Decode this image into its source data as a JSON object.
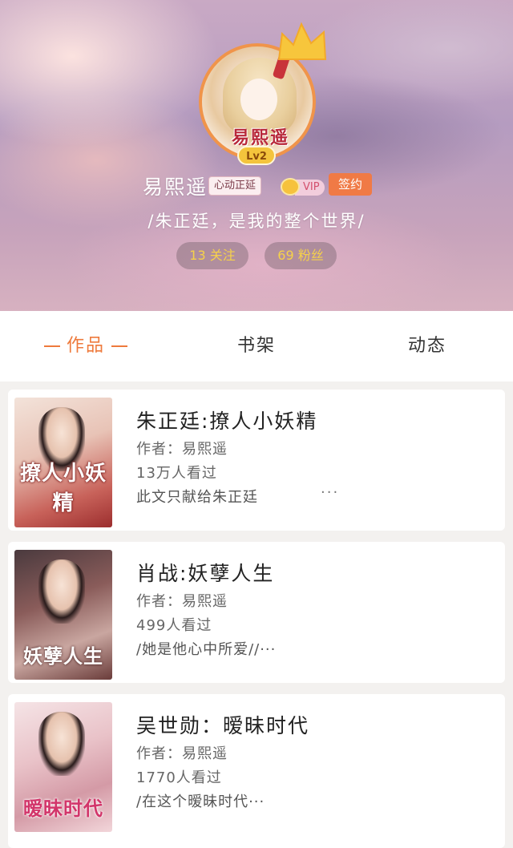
{
  "profile": {
    "username": "易熙遥",
    "tag": "心动正延",
    "vip_label": "VIP",
    "sign_label": "签约",
    "level": "Lv2",
    "avatar_signature": "易熙遥",
    "bio": "/朱正廷，是我的整个世界/",
    "following": "13 关注",
    "fans": "69 粉丝"
  },
  "tabs": {
    "works": "作品",
    "shelf": "书架",
    "feed": "动态",
    "active": "works"
  },
  "books": [
    {
      "title": "朱正廷:撩人小妖精",
      "author": "作者：易熙遥",
      "views": "13万人看过",
      "desc": "此文只献给朱正廷",
      "more": "···",
      "cover_text": "撩人小妖精"
    },
    {
      "title": "肖战:妖孽人生",
      "author": "作者：易熙遥",
      "views": "499人看过",
      "desc": "/她是他心中所爱//···",
      "cover_text": "妖孽人生"
    },
    {
      "title": "吴世勋：暧昧时代",
      "author": "作者：易熙遥",
      "views": "1770人看过",
      "desc": "/在这个暧昧时代···",
      "cover_text": "暧昧时代"
    }
  ],
  "colors": {
    "accent": "#ee7a3c",
    "sign_badge": "#f07a45",
    "stat_text": "#f6d14a",
    "level_badge": "#f4c43c"
  },
  "icons": {
    "crown": "crown-icon",
    "vip": "vip-crown-icon",
    "more": "more-dots-icon"
  }
}
